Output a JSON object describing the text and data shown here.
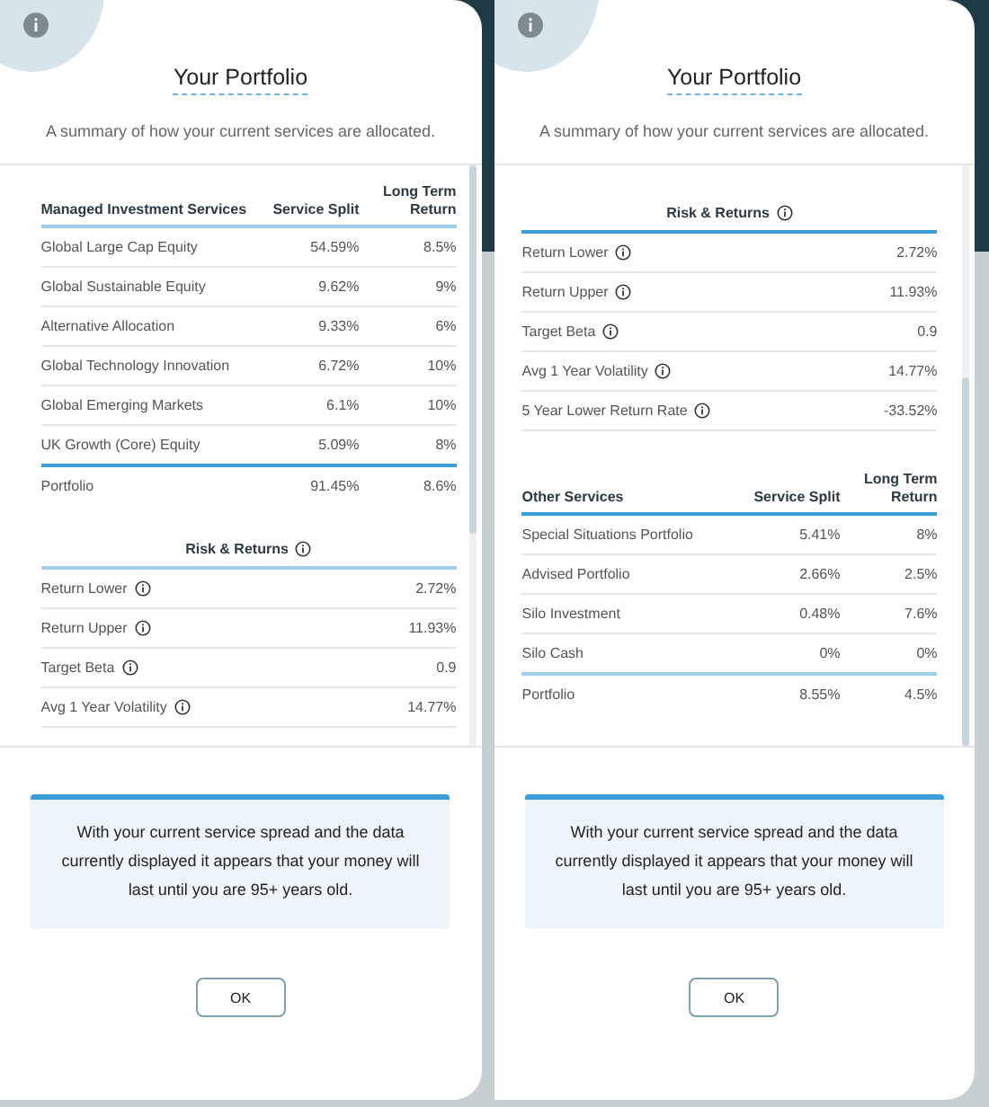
{
  "panels": [
    {
      "title": "Your Portfolio",
      "subtitle": "A summary of how your current services are allocated.",
      "sections": [
        {
          "kind": "services",
          "columns": [
            "Managed Investment Services",
            "Service Split",
            "Long Term Return"
          ],
          "rows": [
            {
              "name": "Global Large Cap Equity",
              "split": "54.59%",
              "ret": "8.5%"
            },
            {
              "name": "Global Sustainable Equity",
              "split": "9.62%",
              "ret": "9%"
            },
            {
              "name": "Alternative Allocation",
              "split": "9.33%",
              "ret": "6%"
            },
            {
              "name": "Global Technology Innovation",
              "split": "6.72%",
              "ret": "10%"
            },
            {
              "name": "Global Emerging Markets",
              "split": "6.1%",
              "ret": "10%"
            },
            {
              "name": "UK Growth (Core) Equity",
              "split": "5.09%",
              "ret": "8%"
            }
          ],
          "total": {
            "name": "Portfolio",
            "split": "91.45%",
            "ret": "8.6%"
          }
        },
        {
          "kind": "risk",
          "heading": "Risk & Returns",
          "rows": [
            {
              "name": "Return Lower",
              "value": "2.72%"
            },
            {
              "name": "Return Upper",
              "value": "11.93%"
            },
            {
              "name": "Target Beta",
              "value": "0.9"
            },
            {
              "name": "Avg 1 Year Volatility",
              "value": "14.77%"
            }
          ]
        }
      ],
      "note": "With your current service spread and the data currently displayed it appears that your money will last until you are 95+ years old.",
      "button": "OK"
    },
    {
      "title": "Your Portfolio",
      "subtitle": "A summary of how your current services are allocated.",
      "sections": [
        {
          "kind": "risk",
          "heading": "Risk & Returns",
          "rows": [
            {
              "name": "Return Lower",
              "value": "2.72%"
            },
            {
              "name": "Return Upper",
              "value": "11.93%"
            },
            {
              "name": "Target Beta",
              "value": "0.9"
            },
            {
              "name": "Avg 1 Year Volatility",
              "value": "14.77%"
            },
            {
              "name": "5 Year Lower Return Rate",
              "value": "-33.52%"
            }
          ]
        },
        {
          "kind": "services",
          "columns": [
            "Other Services",
            "Service Split",
            "Long Term Return"
          ],
          "rows": [
            {
              "name": "Special Situations Portfolio",
              "split": "5.41%",
              "ret": "8%"
            },
            {
              "name": "Advised Portfolio",
              "split": "2.66%",
              "ret": "2.5%"
            },
            {
              "name": "Silo Investment",
              "split": "0.48%",
              "ret": "7.6%"
            },
            {
              "name": "Silo Cash",
              "split": "0%",
              "ret": "0%"
            }
          ],
          "total": {
            "name": "Portfolio",
            "split": "8.55%",
            "ret": "4.5%"
          }
        }
      ],
      "note": "With your current service spread and the data currently displayed it appears that your money will last until you are 95+ years old.",
      "button": "OK"
    }
  ]
}
